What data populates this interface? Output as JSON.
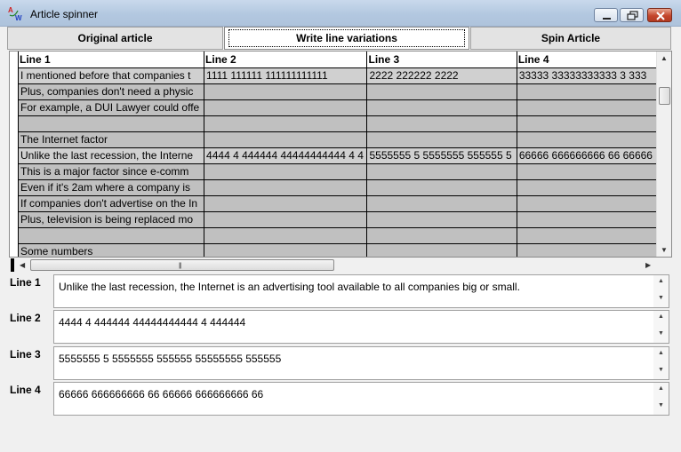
{
  "window": {
    "title": "Article spinner"
  },
  "tabs": [
    {
      "label": "Original article"
    },
    {
      "label": "Write line variations"
    },
    {
      "label": "Spin Article"
    }
  ],
  "grid": {
    "columns": [
      "Line 1",
      "Line 2",
      "Line 3",
      "Line 4"
    ],
    "rows": [
      [
        "I mentioned before that companies t",
        "1111 111111 111111111111",
        "2222 222222 2222",
        "33333 33333333333  3 333"
      ],
      [
        "Plus, companies don't need a physic",
        "",
        "",
        ""
      ],
      [
        "For example, a DUI Lawyer could offe",
        "",
        "",
        ""
      ],
      [
        "",
        "",
        "",
        ""
      ],
      [
        "The Internet factor",
        "",
        "",
        ""
      ],
      [
        "Unlike the last recession, the Interne",
        "4444 4 444444 44444444444 4 4",
        "5555555 5 5555555 555555 5",
        "66666 666666666 66 66666"
      ],
      [
        "This is a major factor since e-comm",
        "",
        "",
        ""
      ],
      [
        "Even if it's 2am where a company is",
        "",
        "",
        ""
      ],
      [
        "If companies don't advertise on the In",
        "",
        "",
        ""
      ],
      [
        "Plus, television is being replaced mo",
        "",
        "",
        ""
      ],
      [
        "",
        "",
        "",
        ""
      ],
      [
        "Some numbers",
        "",
        "",
        ""
      ]
    ]
  },
  "editors": [
    {
      "label": "Line 1",
      "value": "Unlike the last recession, the Internet is an advertising tool available to all companies big or small."
    },
    {
      "label": "Line 2",
      "value": "4444 4 444444 44444444444 4 444444"
    },
    {
      "label": "Line 3",
      "value": "5555555 5 5555555 555555 55555555 555555"
    },
    {
      "label": "Line 4",
      "value": "66666 666666666 66 66666 666666666 66"
    }
  ]
}
